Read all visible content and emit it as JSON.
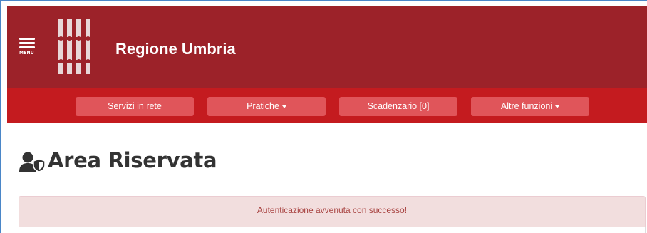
{
  "header": {
    "menu_label": "MENU",
    "title": "Regione Umbria",
    "bg_color": "#9c2229"
  },
  "nav": {
    "bg_color": "#c41b1f",
    "items": [
      {
        "label": "Servizi in rete",
        "dropdown": false
      },
      {
        "label": "Pratiche",
        "dropdown": true
      },
      {
        "label": "Scadenzario [0]",
        "dropdown": false
      },
      {
        "label": "Altre funzioni",
        "dropdown": true
      }
    ]
  },
  "main": {
    "title": "Area Riservata",
    "title_icon": "user-shield-icon"
  },
  "alert": {
    "message": "Autenticazione avvenuta con successo!",
    "type": "danger"
  }
}
